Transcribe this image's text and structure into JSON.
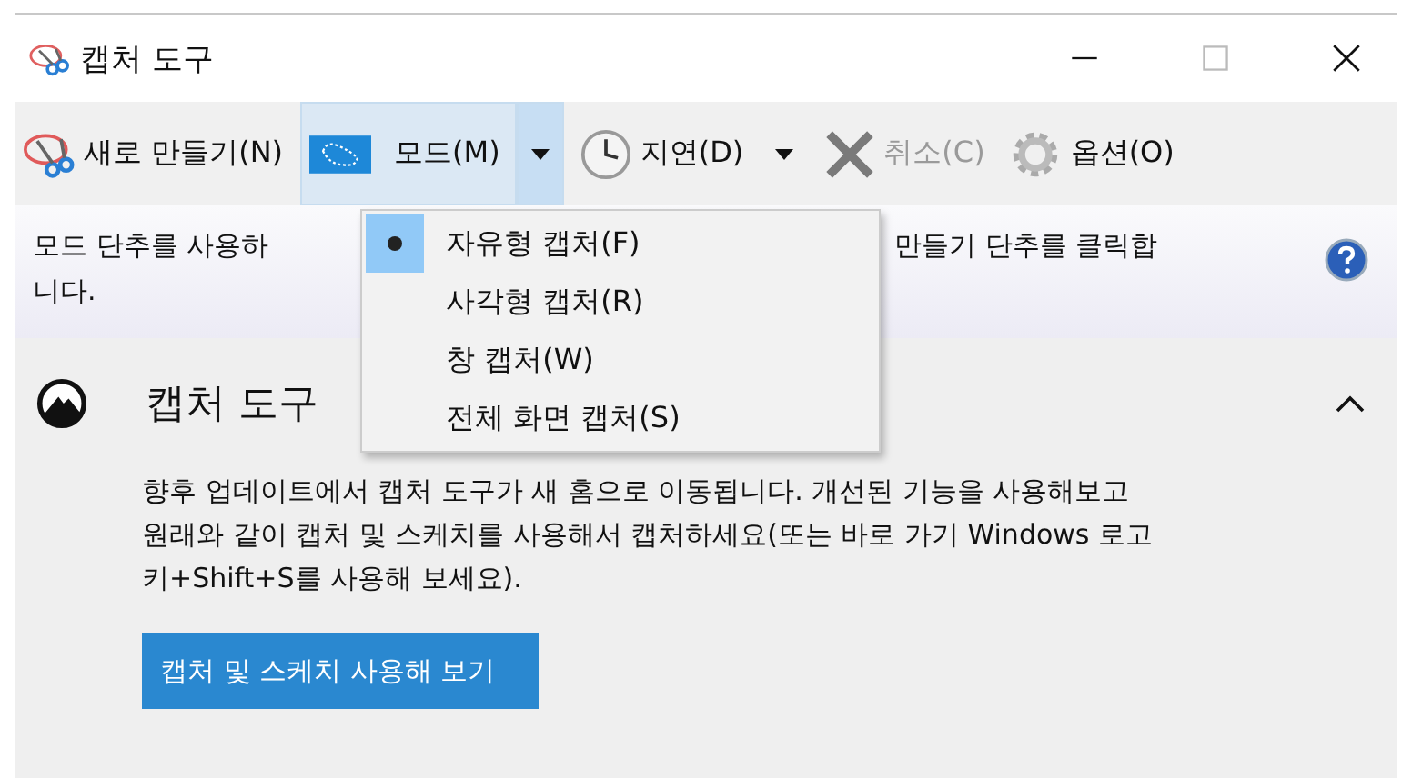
{
  "window": {
    "title": "캡처 도구"
  },
  "toolbar": [
    {
      "kind": "button",
      "label": "새로 만들기(N)",
      "disabled": false,
      "pressed": false
    },
    {
      "kind": "split",
      "label": "모드(M)",
      "disabled": false,
      "pressed": true
    },
    {
      "kind": "split",
      "label": "지연(D)",
      "disabled": false,
      "pressed": false
    },
    {
      "kind": "button",
      "label": "취소(C)",
      "disabled": true,
      "pressed": false
    },
    {
      "kind": "button",
      "label": "옵션(O)",
      "disabled": false,
      "pressed": false
    }
  ],
  "hint": {
    "line_1_left": "모드 단추를 사용하",
    "line_1_right": "만들기 단추를 클릭합",
    "line_2": "니다."
  },
  "mode_menu": [
    {
      "label": "자유형 캡처(F)",
      "selected": true
    },
    {
      "label": "사각형 캡처(R)",
      "selected": false
    },
    {
      "label": "창 캡처(W)",
      "selected": false
    },
    {
      "label": "전체 화면 캡처(S)",
      "selected": false
    }
  ],
  "notice": {
    "title": "캡처 도구",
    "expanded": true,
    "text": "향후 업데이트에서 캡처 도구가 새 홈으로 이동됩니다. 개선된 기능을 사용해보고 원래와 같이 캡처 및 스케치를 사용해서 캡처하세요(또는 바로 가기 Windows 로고 키+Shift+S를 사용해 보세요).",
    "button": "캡처 및 스케치 사용해 보기"
  }
}
